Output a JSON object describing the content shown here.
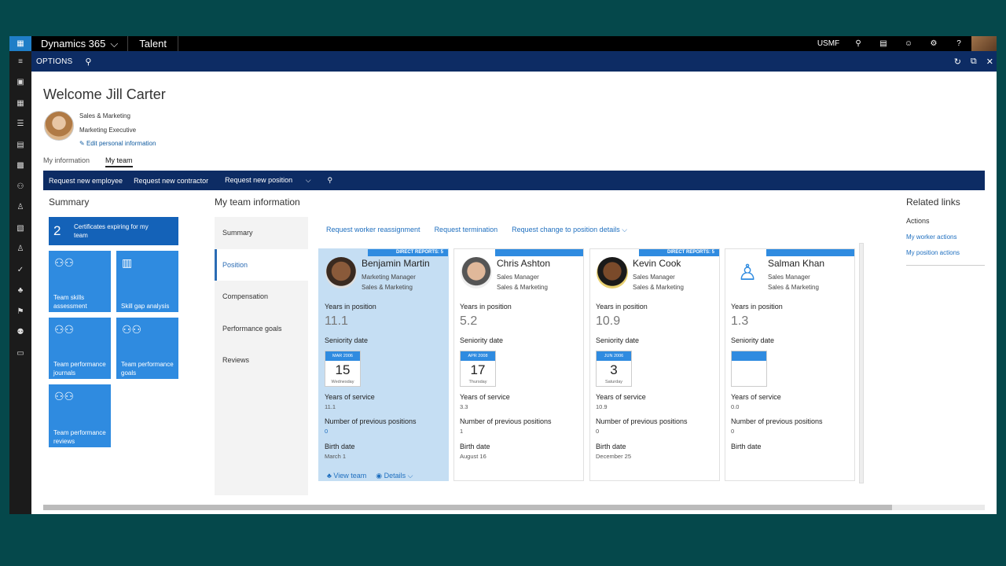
{
  "app": {
    "brand": "Dynamics 365",
    "module": "Talent",
    "company": "USMF"
  },
  "options": {
    "label": "OPTIONS"
  },
  "profile": {
    "welcome": "Welcome Jill Carter",
    "dept": "Sales & Marketing",
    "title": "Marketing Executive",
    "edit": "Edit personal information"
  },
  "tabs": {
    "info": "My information",
    "team": "My team"
  },
  "actions": {
    "new_employee": "Request new employee",
    "new_contractor": "Request new contractor",
    "new_position": "Request new position"
  },
  "summary": {
    "title": "Summary",
    "cert_count": "2",
    "cert_label": "Certificates expiring for my team",
    "tiles": [
      "Team skills assessment",
      "Skill gap analysis",
      "Team performance journals",
      "Team performance goals",
      "Team performance reviews"
    ]
  },
  "team": {
    "title": "My team information",
    "subnav": [
      "Summary",
      "Position",
      "Compensation",
      "Performance goals",
      "Reviews"
    ],
    "links": [
      "Request worker reassignment",
      "Request termination",
      "Request change to position details"
    ],
    "labels": {
      "years_pos": "Years in position",
      "seniority": "Seniority date",
      "years_service": "Years of service",
      "prev_pos": "Number of previous positions",
      "birth": "Birth date",
      "view_team": "View team",
      "details": "Details"
    },
    "cards": [
      {
        "strip": "DIRECT REPORTS: 5",
        "name": "Benjamin Martin",
        "job": "Marketing Manager",
        "dept": "Sales & Marketing",
        "years_pos": "11.1",
        "cal_month": "MAR 2006",
        "cal_day": "15",
        "cal_wd": "Wednesday",
        "years_service": "11.1",
        "prev": "0",
        "birth": "March 1"
      },
      {
        "strip": "",
        "name": "Chris Ashton",
        "job": "Sales Manager",
        "dept": "Sales & Marketing",
        "years_pos": "5.2",
        "cal_month": "APR 2008",
        "cal_day": "17",
        "cal_wd": "Thursday",
        "years_service": "3.3",
        "prev": "1",
        "birth": "August 16"
      },
      {
        "strip": "DIRECT REPORTS: 5",
        "name": "Kevin Cook",
        "job": "Sales Manager",
        "dept": "Sales & Marketing",
        "years_pos": "10.9",
        "cal_month": "JUN 2006",
        "cal_day": "3",
        "cal_wd": "Saturday",
        "years_service": "10.9",
        "prev": "0",
        "birth": "December 25"
      },
      {
        "strip": "",
        "name": "Salman Khan",
        "job": "Sales Manager",
        "dept": "Sales & Marketing",
        "years_pos": "1.3",
        "cal_month": "",
        "cal_day": "",
        "cal_wd": "",
        "years_service": "0.0",
        "prev": "0",
        "birth": ""
      }
    ]
  },
  "related": {
    "title": "Related links",
    "actions": "Actions",
    "worker": "My worker actions",
    "position": "My position actions"
  },
  "colors": {
    "accent": "#2f8be0",
    "navy": "#0d2c64",
    "highlight": "#c5def3"
  }
}
